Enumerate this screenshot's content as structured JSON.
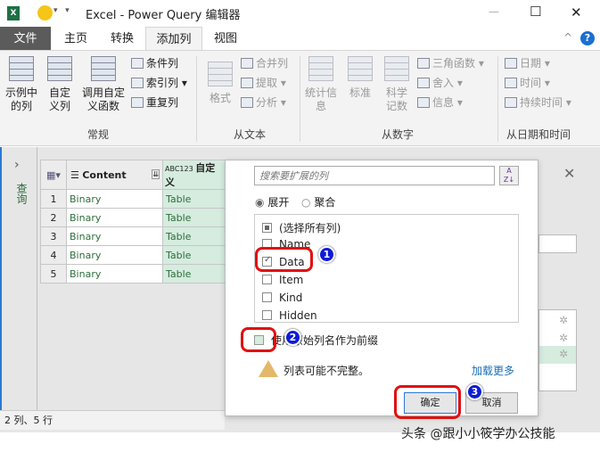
{
  "window": {
    "title": "Excel - Power Query 编辑器",
    "minimize": "—",
    "maximize": "☐",
    "close": "✕"
  },
  "tabs": [
    {
      "label": "文件"
    },
    {
      "label": "主页"
    },
    {
      "label": "转换"
    },
    {
      "label": "添加列"
    },
    {
      "label": "视图"
    }
  ],
  "ribbon": {
    "general": {
      "label": "常规",
      "example": "示例中的列",
      "custom": "自定义列",
      "invoke": "调用自定义函数",
      "conditional": "条件列",
      "index": "索引列",
      "duplicate": "重复列"
    },
    "text": {
      "label": "从文本",
      "format": "格式",
      "merge": "合并列",
      "extract": "提取",
      "parse": "分析"
    },
    "number": {
      "label": "从数字",
      "stats": "统计信息",
      "standard": "标准",
      "sci": "科学记数",
      "trig": "三角函数",
      "round": "舍入",
      "info": "信息"
    },
    "datetime": {
      "label": "从日期和时间",
      "date": "日期",
      "time": "时间",
      "duration": "持续时间"
    }
  },
  "sidebar": {
    "label": "查询"
  },
  "table": {
    "headers": [
      "Content",
      "自定义"
    ],
    "rows": [
      [
        "1",
        "Binary",
        "Table"
      ],
      [
        "2",
        "Binary",
        "Table"
      ],
      [
        "3",
        "Binary",
        "Table"
      ],
      [
        "4",
        "Binary",
        "Table"
      ],
      [
        "5",
        "Binary",
        "Table"
      ]
    ]
  },
  "status": "2 列、5 行",
  "dialog": {
    "search_placeholder": "搜索要扩展的列",
    "expand": "展开",
    "aggregate": "聚合",
    "columns": [
      {
        "label": "(选择所有列)",
        "state": "partial"
      },
      {
        "label": "Name",
        "state": "off"
      },
      {
        "label": "Data",
        "state": "on"
      },
      {
        "label": "Item",
        "state": "off"
      },
      {
        "label": "Kind",
        "state": "off"
      },
      {
        "label": "Hidden",
        "state": "off"
      }
    ],
    "prefix": "使用原始列名作为前缀",
    "warning": "列表可能不完整。",
    "load_more": "加载更多",
    "ok": "确定",
    "cancel": "取消"
  },
  "badges": [
    "1",
    "2",
    "3"
  ],
  "watermark": "头条 @跟小小筱学办公技能"
}
